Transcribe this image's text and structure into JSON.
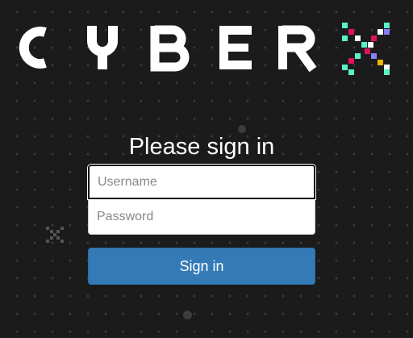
{
  "brand": {
    "wordmark": "CYBER",
    "mark": "X",
    "text_color": "#ffffff",
    "pixel_colors": [
      "#ffffff",
      "#e0115f",
      "#5cf0c8",
      "#f5b400",
      "#8a7cf5"
    ]
  },
  "page": {
    "background": "#1b1b1b"
  },
  "login": {
    "heading": "Please sign in",
    "username_placeholder": "Username",
    "password_placeholder": "Password",
    "username_value": "",
    "password_value": "",
    "submit_label": "Sign in",
    "submit_color": "#337ab7"
  }
}
